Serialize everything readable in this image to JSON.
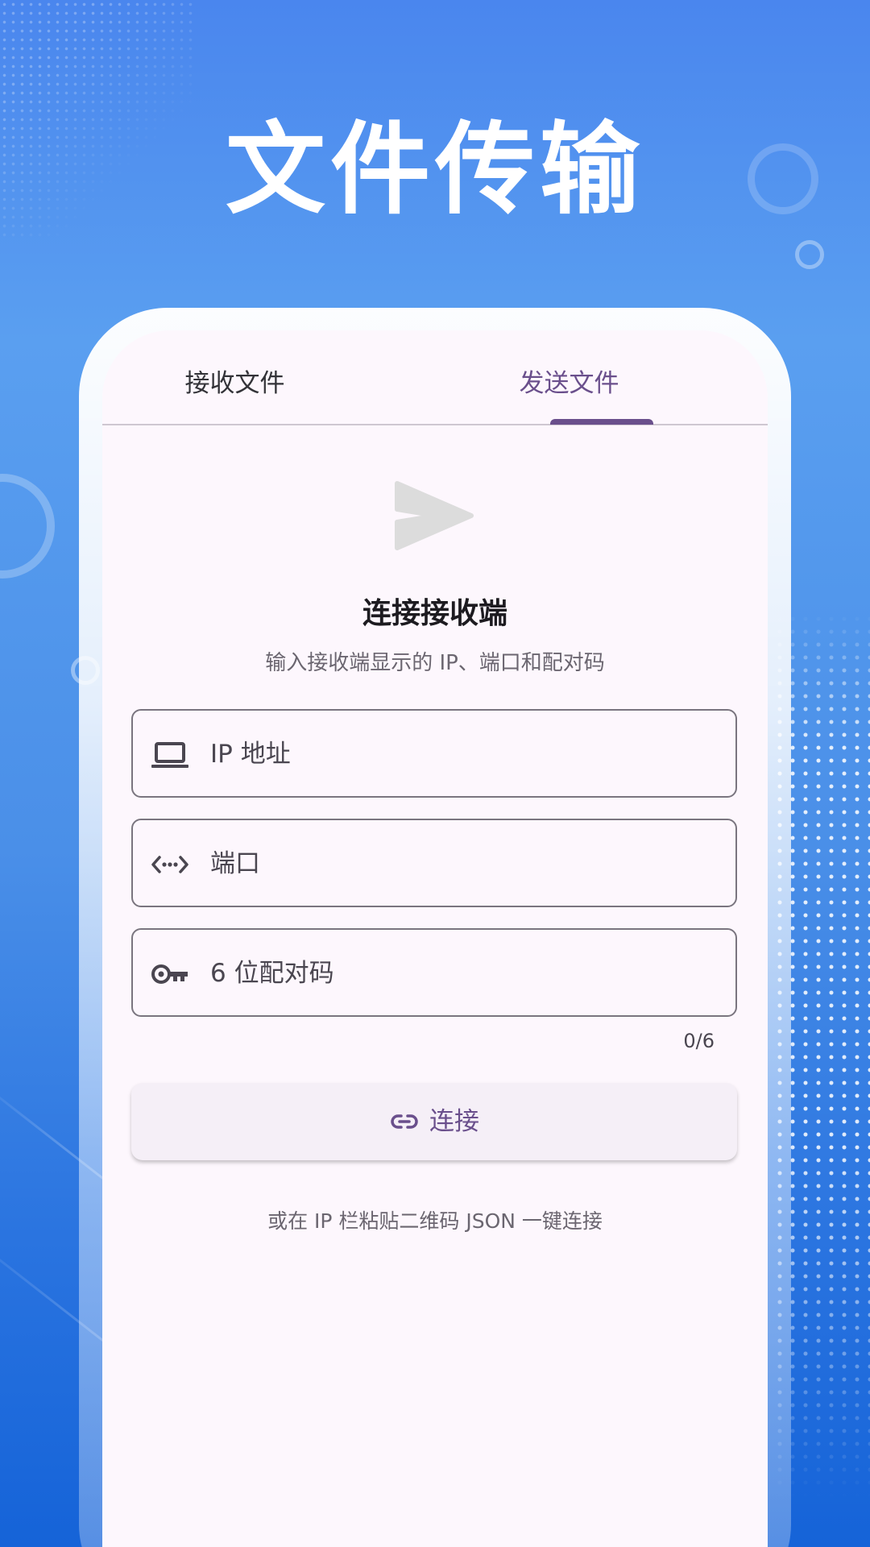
{
  "banner": {
    "title": "文件传输"
  },
  "tabs": [
    {
      "label": "接收文件",
      "selected": false
    },
    {
      "label": "发送文件",
      "selected": true
    }
  ],
  "connect_panel": {
    "icon": "send-icon",
    "title": "连接接收端",
    "subtitle": "输入接收端显示的 IP、端口和配对码"
  },
  "form": {
    "ip": {
      "placeholder": "IP 地址",
      "icon": "laptop-icon",
      "value": ""
    },
    "port": {
      "placeholder": "端口",
      "icon": "code-dots-icon",
      "value": ""
    },
    "pair_code": {
      "placeholder": "6 位配对码",
      "icon": "key-icon",
      "value": "",
      "counter": "0/6"
    }
  },
  "connect_button": {
    "label": "连接",
    "icon": "link-icon"
  },
  "hint": "或在 IP 栏粘贴二维码 JSON 一键连接",
  "colors": {
    "background_top": "#4a86ee",
    "background_bottom": "#1563d8",
    "screen_bg": "#fdf7fd",
    "accent": "#6a4f8c",
    "text_primary": "#1d1b20",
    "text_secondary": "#6b6670",
    "field_border": "#7a757f"
  }
}
